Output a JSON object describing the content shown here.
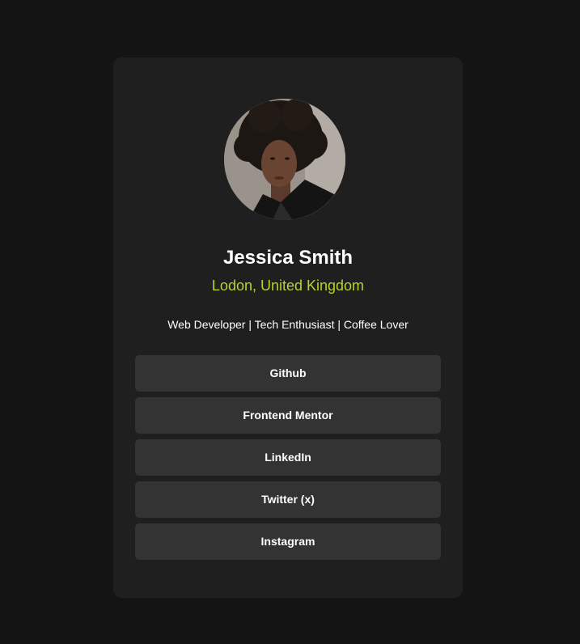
{
  "profile": {
    "name": "Jessica Smith",
    "location": "Lodon, United Kingdom",
    "bio": "Web Developer | Tech Enthusiast | Coffee Lover"
  },
  "links": [
    {
      "label": "Github"
    },
    {
      "label": "Frontend Mentor"
    },
    {
      "label": "LinkedIn"
    },
    {
      "label": "Twitter (x)"
    },
    {
      "label": "Instagram"
    }
  ],
  "colors": {
    "page_background": "#141414",
    "card_background": "#1f1f1f",
    "button_background": "#333333",
    "accent": "#b7d22f",
    "text": "#ffffff"
  }
}
